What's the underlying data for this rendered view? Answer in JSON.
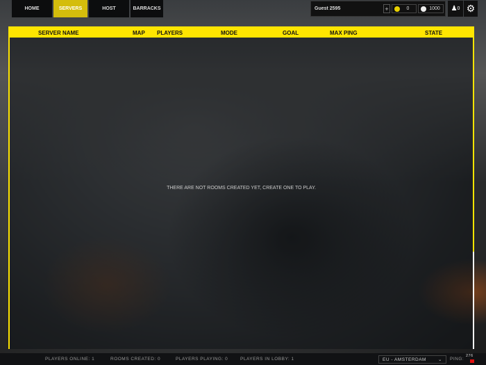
{
  "nav": {
    "tabs": [
      {
        "label": "HOME"
      },
      {
        "label": "SERVERS",
        "active": true
      },
      {
        "label": "HOST"
      },
      {
        "label": "BARRACKS"
      }
    ]
  },
  "user": {
    "name": "Guest 2595",
    "add_label": "+",
    "gold": "0",
    "credits": "1000",
    "friends_count": "0"
  },
  "table": {
    "columns": [
      "SERVER NAME",
      "MAP",
      "PLAYERS",
      "MODE",
      "GOAL",
      "MAX PING",
      "STATE"
    ],
    "empty_message": "THERE ARE NOT ROOMS CREATED YET, CREATE ONE TO PLAY."
  },
  "footer": {
    "players_online": "PLAYERS ONLINE: 1",
    "rooms_created": "ROOMS CREATED: 0",
    "players_playing": "PLAYERS PLAYING: 0",
    "players_in_lobby": "PLAYERS IN LOBBY: 1",
    "region": "EU - AMSTERDAM",
    "ping_label": "PING:",
    "ping_value": "276"
  },
  "colors": {
    "accent": "#ffe500",
    "active_tab": "#d4bd0c"
  }
}
